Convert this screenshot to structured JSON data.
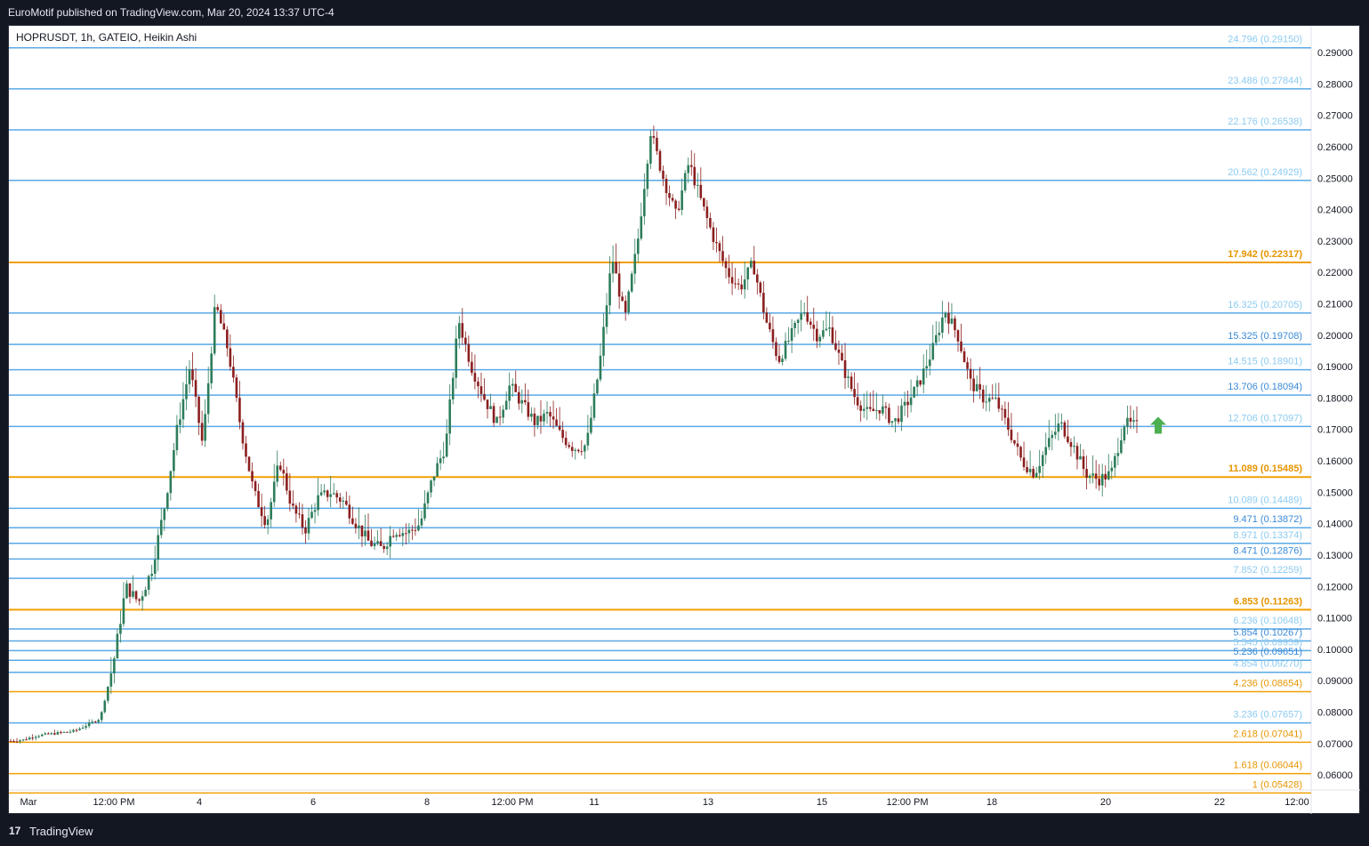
{
  "header": {
    "publisher": "EuroMotif published on TradingView.com, Mar 20, 2024 13:37 UTC-4"
  },
  "footer": {
    "logo_glyph": "17",
    "brand": "TradingView"
  },
  "colors": {
    "background": "#131722",
    "plot_bg": "#ffffff",
    "level_blue": "#5aa9e6",
    "level_orange": "#f29f05",
    "label_blue_light": "#8ccbf2",
    "label_blue_dark": "#3a8ad6",
    "label_orange": "#e69500",
    "candle_up": "#2e7d5b",
    "candle_down": "#8b1f1f",
    "arrow": "#4caf50"
  },
  "chart_data": {
    "type": "candlestick",
    "title": "HOPRUSDT, 1h, GATEIO, Heikin Ashi",
    "ylim": [
      0.0558,
      0.2985
    ],
    "y_ticks": [
      "0.29000",
      "0.28000",
      "0.27000",
      "0.26000",
      "0.25000",
      "0.24000",
      "0.23000",
      "0.22000",
      "0.21000",
      "0.20000",
      "0.19000",
      "0.18000",
      "0.17000",
      "0.16000",
      "0.15000",
      "0.14000",
      "0.13000",
      "0.12000",
      "0.11000",
      "0.10000",
      "0.09000",
      "0.08000",
      "0.07000",
      "0.06000"
    ],
    "x_ticks": [
      "Mar",
      "12:00 PM",
      "4",
      "6",
      "8",
      "12:00 PM",
      "11",
      "13",
      "15",
      "12:00 PM",
      "18",
      "20",
      "22",
      "12:00"
    ],
    "levels": [
      {
        "label": "24.796 (0.29150)",
        "value": 0.2915,
        "color": "blue",
        "weight": "normal"
      },
      {
        "label": "23.486 (0.27844)",
        "value": 0.27844,
        "color": "blue",
        "weight": "normal"
      },
      {
        "label": "22.176 (0.26538)",
        "value": 0.26538,
        "color": "blue",
        "weight": "normal"
      },
      {
        "label": "20.562 (0.24929)",
        "value": 0.24929,
        "color": "blue",
        "weight": "normal"
      },
      {
        "label": "17.942 (0.22317)",
        "value": 0.22317,
        "color": "orange",
        "weight": "bold"
      },
      {
        "label": "16.325 (0.20705)",
        "value": 0.20705,
        "color": "blue",
        "weight": "normal"
      },
      {
        "label": "15.325 (0.19708)",
        "value": 0.19708,
        "color": "blue-dark",
        "weight": "normal"
      },
      {
        "label": "14.515 (0.18901)",
        "value": 0.18901,
        "color": "blue",
        "weight": "normal"
      },
      {
        "label": "13.706 (0.18094)",
        "value": 0.18094,
        "color": "blue-dark",
        "weight": "normal"
      },
      {
        "label": "12.706 (0.17097)",
        "value": 0.17097,
        "color": "blue",
        "weight": "normal"
      },
      {
        "label": "11.089 (0.15485)",
        "value": 0.15485,
        "color": "orange",
        "weight": "bold"
      },
      {
        "label": "10.089 (0.14489)",
        "value": 0.14489,
        "color": "blue",
        "weight": "normal"
      },
      {
        "label": "9.471 (0.13872)",
        "value": 0.13872,
        "color": "blue-dark",
        "weight": "normal"
      },
      {
        "label": "8.971 (0.13374)",
        "value": 0.13374,
        "color": "blue",
        "weight": "normal"
      },
      {
        "label": "8.471 (0.12876)",
        "value": 0.12876,
        "color": "blue-dark",
        "weight": "normal"
      },
      {
        "label": "7.852 (0.12259)",
        "value": 0.12259,
        "color": "blue",
        "weight": "normal"
      },
      {
        "label": "6.853 (0.11263)",
        "value": 0.11263,
        "color": "orange",
        "weight": "bold"
      },
      {
        "label": "6.236 (0.10648)",
        "value": 0.10648,
        "color": "blue",
        "weight": "normal"
      },
      {
        "label": "5.854 (0.10267)",
        "value": 0.10267,
        "color": "blue-dark",
        "weight": "normal"
      },
      {
        "label": "5.545 (0.09959)",
        "value": 0.09959,
        "color": "blue",
        "weight": "normal"
      },
      {
        "label": "5.236 (0.09651)",
        "value": 0.09651,
        "color": "blue-dark",
        "weight": "normal"
      },
      {
        "label": "4.854 (0.09270)",
        "value": 0.0927,
        "color": "blue",
        "weight": "normal"
      },
      {
        "label": "4.236 (0.08654)",
        "value": 0.08654,
        "color": "orange",
        "weight": "normal"
      },
      {
        "label": "3.236 (0.07657)",
        "value": 0.07657,
        "color": "blue",
        "weight": "normal"
      },
      {
        "label": "2.618 (0.07041)",
        "value": 0.07041,
        "color": "orange",
        "weight": "normal"
      },
      {
        "label": "1.618 (0.06044)",
        "value": 0.06044,
        "color": "orange",
        "weight": "normal"
      },
      {
        "label": "1 (0.05428)",
        "value": 0.05428,
        "color": "orange",
        "weight": "normal"
      }
    ],
    "price_path": [
      [
        "Mar 1",
        0.0708
      ],
      [
        "Mar 2",
        0.0712
      ],
      [
        "Mar 2",
        0.0725
      ],
      [
        "Mar 2",
        0.073
      ],
      [
        "Mar 3",
        0.0735
      ],
      [
        "Mar 3",
        0.074
      ],
      [
        "Mar 3",
        0.076
      ],
      [
        "Mar 3",
        0.078
      ],
      [
        "Mar 3",
        0.095
      ],
      [
        "Mar 3",
        0.12
      ],
      [
        "Mar 3",
        0.115
      ],
      [
        "Mar 4",
        0.125
      ],
      [
        "Mar 4",
        0.145
      ],
      [
        "Mar 4",
        0.17
      ],
      [
        "Mar 4",
        0.19
      ],
      [
        "Mar 4",
        0.165
      ],
      [
        "Mar 4",
        0.21
      ],
      [
        "Mar 4",
        0.195
      ],
      [
        "Mar 5",
        0.17
      ],
      [
        "Mar 5",
        0.15
      ],
      [
        "Mar 5",
        0.14
      ],
      [
        "Mar 5",
        0.16
      ],
      [
        "Mar 5",
        0.145
      ],
      [
        "Mar 6",
        0.138
      ],
      [
        "Mar 6",
        0.148
      ],
      [
        "Mar 6",
        0.15
      ],
      [
        "Mar 6",
        0.147
      ],
      [
        "Mar 7",
        0.14
      ],
      [
        "Mar 7",
        0.134
      ],
      [
        "Mar 7",
        0.132
      ],
      [
        "Mar 8",
        0.138
      ],
      [
        "Mar 8",
        0.137
      ],
      [
        "Mar 8",
        0.14
      ],
      [
        "Mar 8",
        0.155
      ],
      [
        "Mar 9",
        0.165
      ],
      [
        "Mar 9",
        0.205
      ],
      [
        "Mar 9",
        0.19
      ],
      [
        "Mar 9",
        0.18
      ],
      [
        "Mar 10",
        0.172
      ],
      [
        "Mar 10",
        0.184
      ],
      [
        "Mar 10",
        0.178
      ],
      [
        "Mar 10",
        0.172
      ],
      [
        "Mar 11",
        0.175
      ],
      [
        "Mar 11",
        0.168
      ],
      [
        "Mar 11",
        0.164
      ],
      [
        "Mar 12",
        0.165
      ],
      [
        "Mar 12",
        0.19
      ],
      [
        "Mar 12",
        0.225
      ],
      [
        "Mar 12",
        0.205
      ],
      [
        "Mar 12",
        0.23
      ],
      [
        "Mar 13",
        0.265
      ],
      [
        "Mar 13",
        0.25
      ],
      [
        "Mar 13",
        0.238
      ],
      [
        "Mar 13",
        0.255
      ],
      [
        "Mar 14",
        0.242
      ],
      [
        "Mar 14",
        0.23
      ],
      [
        "Mar 14",
        0.22
      ],
      [
        "Mar 14",
        0.215
      ],
      [
        "Mar 14",
        0.223
      ],
      [
        "Mar 15",
        0.205
      ],
      [
        "Mar 15",
        0.192
      ],
      [
        "Mar 15",
        0.2
      ],
      [
        "Mar 15",
        0.208
      ],
      [
        "Mar 15",
        0.2
      ],
      [
        "Mar 16",
        0.202
      ],
      [
        "Mar 16",
        0.19
      ],
      [
        "Mar 16",
        0.18
      ],
      [
        "Mar 16",
        0.175
      ],
      [
        "Mar 17",
        0.177
      ],
      [
        "Mar 17",
        0.172
      ],
      [
        "Mar 17",
        0.178
      ],
      [
        "Mar 17",
        0.185
      ],
      [
        "Mar 17",
        0.195
      ],
      [
        "Mar 18",
        0.208
      ],
      [
        "Mar 18",
        0.2
      ],
      [
        "Mar 18",
        0.185
      ],
      [
        "Mar 18",
        0.18
      ],
      [
        "Mar 18",
        0.179
      ],
      [
        "Mar 19",
        0.17
      ],
      [
        "Mar 19",
        0.16
      ],
      [
        "Mar 19",
        0.156
      ],
      [
        "Mar 19",
        0.165
      ],
      [
        "Mar 19",
        0.172
      ],
      [
        "Mar 19",
        0.165
      ],
      [
        "Mar 20",
        0.156
      ],
      [
        "Mar 20",
        0.154
      ],
      [
        "Mar 20",
        0.156
      ],
      [
        "Mar 20",
        0.172
      ],
      [
        "Mar 20",
        0.171
      ]
    ]
  }
}
